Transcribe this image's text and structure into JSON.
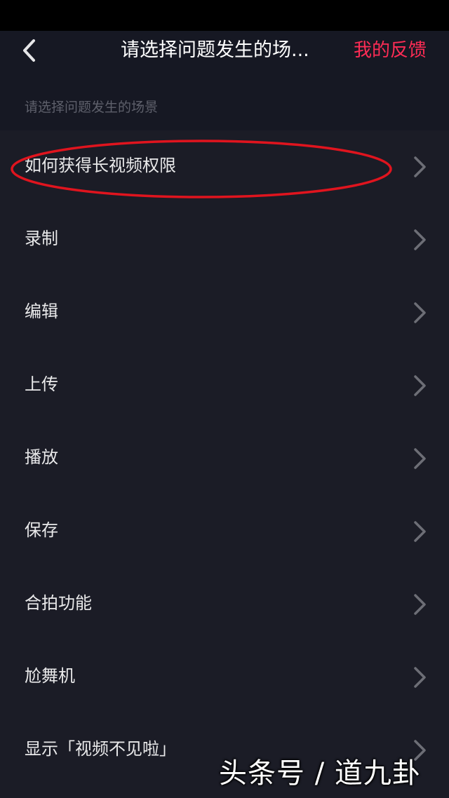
{
  "header": {
    "title": "请选择问题发生的场...",
    "feedback_label": "我的反馈"
  },
  "section": {
    "label": "请选择问题发生的场景"
  },
  "items": [
    {
      "label": "如何获得长视频权限"
    },
    {
      "label": "录制"
    },
    {
      "label": "编辑"
    },
    {
      "label": "上传"
    },
    {
      "label": "播放"
    },
    {
      "label": "保存"
    },
    {
      "label": "合拍功能"
    },
    {
      "label": "尬舞机"
    },
    {
      "label": "显示「视频不见啦」"
    }
  ],
  "watermark": "头条号 / 道九卦",
  "colors": {
    "accent": "#fe2c55",
    "annotation": "#e0141e",
    "background": "#161823",
    "list_background": "#1b1c26"
  }
}
